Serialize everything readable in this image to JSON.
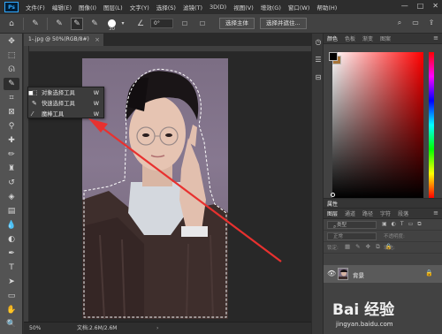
{
  "app": {
    "logo": "Ps",
    "menus": [
      "文件(F)",
      "编辑(E)",
      "图像(I)",
      "图层(L)",
      "文字(Y)",
      "选择(S)",
      "滤镜(T)",
      "3D(D)",
      "视图(V)",
      "增效(G)",
      "窗口(W)",
      "帮助(H)"
    ],
    "window_controls": [
      "—",
      "□",
      "✕"
    ]
  },
  "options_bar": {
    "brush_size": "30",
    "angle": "0°",
    "select_subject": "选择主体",
    "select_and_mask": "选择并遮住..."
  },
  "document": {
    "tab_title": "1-.jpg @ 50%(RGB/8#)",
    "close": "×"
  },
  "status": {
    "zoom": "50%",
    "doc_size": "文档:2.6M/2.6M",
    "arrow": "›"
  },
  "flyout": {
    "items": [
      {
        "label": "对象选择工具",
        "key": "W",
        "icon": "object-select-icon"
      },
      {
        "label": "快速选择工具",
        "key": "W",
        "icon": "quick-select-icon"
      },
      {
        "label": "魔棒工具",
        "key": "W",
        "icon": "magic-wand-icon"
      }
    ]
  },
  "color_panel": {
    "tabs": [
      "颜色",
      "色板",
      "渐变",
      "图案"
    ],
    "fg_color": "#000000",
    "bg_color": "#a87438"
  },
  "properties": {
    "tab": "属性"
  },
  "layers_panel": {
    "tabs": [
      "图层",
      "通道",
      "路径",
      "字符",
      "段落"
    ],
    "kind_filter": "类型",
    "blend_mode": "正常",
    "opacity_label": "不透明度:",
    "lock_label": "锁定:",
    "fill_label": "填充:",
    "layer_name": "背景"
  },
  "watermark": {
    "logo": "Bai 经验",
    "url": "jingyan.baidu.com"
  }
}
